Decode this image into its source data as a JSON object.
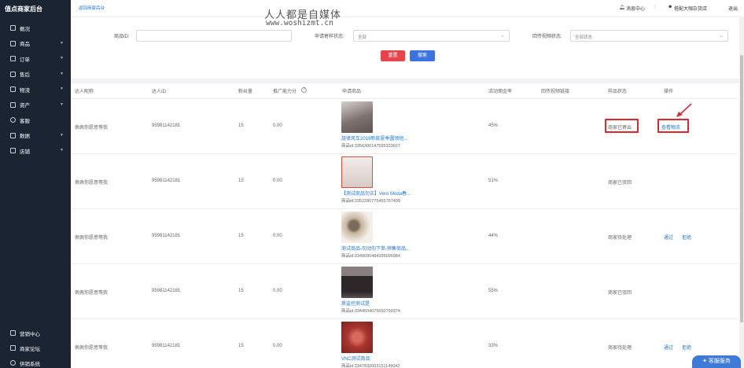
{
  "sidebar": {
    "brand": "值点商家后台",
    "items": [
      {
        "label": "概况",
        "icon": "grid-icon",
        "chevron": false
      },
      {
        "label": "商品",
        "icon": "bag-icon",
        "chevron": true
      },
      {
        "label": "订单",
        "icon": "document-icon",
        "chevron": true
      },
      {
        "label": "售后",
        "icon": "aftersale-icon",
        "chevron": true
      },
      {
        "label": "物流",
        "icon": "truck-icon",
        "chevron": true
      },
      {
        "label": "资产",
        "icon": "wallet-icon",
        "chevron": true
      },
      {
        "label": "客服",
        "icon": "headset-icon",
        "chevron": false
      },
      {
        "label": "数据",
        "icon": "bar-chart-icon",
        "chevron": true
      },
      {
        "label": "店铺",
        "icon": "shop-icon",
        "chevron": true
      }
    ],
    "bottom_items": [
      {
        "label": "营销中心",
        "icon": "megaphone-icon"
      },
      {
        "label": "商家论坛",
        "icon": "forum-icon"
      },
      {
        "label": "供销系统",
        "icon": "supply-icon"
      }
    ]
  },
  "topbar": {
    "breadcrumb": "返回商家后台",
    "watermark_cn": "人人都是自媒体",
    "watermark_url": "www.woshizmt.cn",
    "messages": "消息中心",
    "account": "搭配大咖杂货店",
    "logout": "退出"
  },
  "filters": {
    "product_id_label": "商品ID:",
    "product_id_value": "",
    "sample_status_label": "申请寄样状态:",
    "sample_status_value": "全部",
    "video_status_label": "回传视频状态:",
    "video_status_value": "全部状态",
    "reset_label": "重置",
    "search_label": "搜索"
  },
  "table": {
    "headers": [
      "达人昵称",
      "达人ID",
      "粉丝量",
      "推广能力分",
      "申请商品",
      "活动佣金率",
      "回传视频链接",
      "样品状态",
      "操作"
    ],
    "rows": [
      {
        "nickname": "佩佩你愿意等我",
        "talent_id": "95981142181",
        "fans": "15",
        "score": "0.00",
        "product_name": "旋律风车2019新款夏季圆领短...",
        "product_id": "商品id:3356300147595333627",
        "commission": "45%",
        "video": "",
        "status": "商家已寄出",
        "actions": [
          "查看物流"
        ],
        "thumb_color": "#9a8f8c"
      },
      {
        "nickname": "佩佩你愿意等我",
        "talent_id": "95981142181",
        "fans": "15",
        "score": "0.00",
        "product_name": "【测试商品勿买】Vero Moda春...",
        "product_id": "商品id:3352280775465767499",
        "commission": "51%",
        "video": "",
        "status": "商家已驳回",
        "actions": [],
        "thumb_color": "#e6dcd8"
      },
      {
        "nickname": "佩佩你愿意等我",
        "talent_id": "95981142181",
        "fans": "15",
        "score": "0.00",
        "product_name": "测试商品-勿动勿下单-预售商品...",
        "product_id": "商品id:3349090484395096084",
        "commission": "44%",
        "video": "",
        "status": "商家待处理",
        "actions": [
          "通过",
          "拒绝"
        ],
        "thumb_color": "#c8b9a8"
      },
      {
        "nickname": "佩佩你愿意等我",
        "talent_id": "95981142181",
        "fans": "15",
        "score": "0.00",
        "product_name": "质监控测试是",
        "product_id": "商品id:3344504075650790374",
        "commission": "55%",
        "video": "",
        "status": "商家已驳回",
        "actions": [],
        "thumb_color": "#3a3336"
      },
      {
        "nickname": "佩佩你愿意等我",
        "talent_id": "95981142181",
        "fans": "15",
        "score": "0.00",
        "product_name": "VNC测试商品",
        "product_id": "商品id:3347832003151149042",
        "commission": "33%",
        "video": "",
        "status": "商家待处理",
        "actions": [
          "通过",
          "拒绝"
        ],
        "thumb_color": "#b8413a"
      }
    ]
  },
  "service_button": "客服服务",
  "colors": {
    "sidebar_bg": "#1b2433",
    "link": "#1d75d8",
    "reset": "#e8434b",
    "search": "#3c73e0",
    "highlight": "#e0272c"
  }
}
